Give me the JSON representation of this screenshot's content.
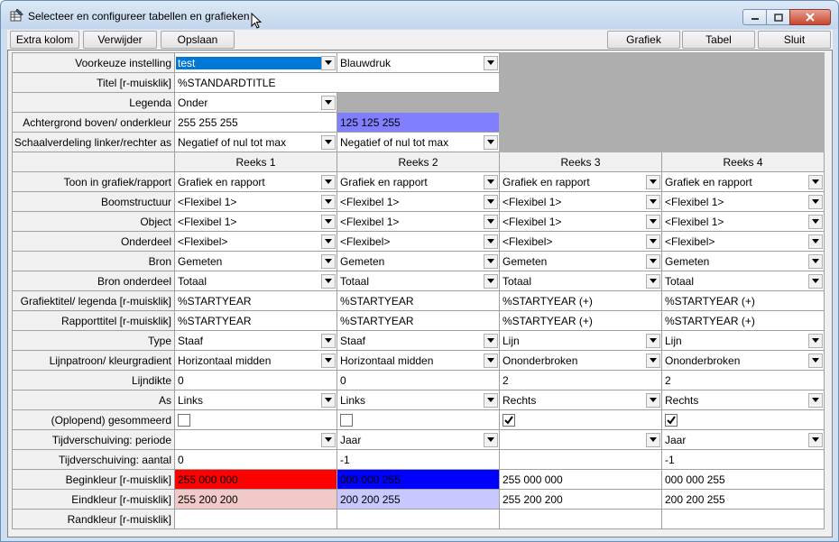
{
  "window": {
    "title": "Selecteer en configureer tabellen en grafieken"
  },
  "toolbar": {
    "extra_kolom": "Extra kolom",
    "verwijder": "Verwijder",
    "opslaan": "Opslaan",
    "grafiek": "Grafiek",
    "tabel": "Tabel",
    "sluit": "Sluit"
  },
  "settings": {
    "voorkeuze_label": "Voorkeuze instelling",
    "voorkeuze_value": "test",
    "voorkeuze_value2": "Blauwdruk",
    "titel_label": "Titel [r-muisklik]",
    "titel_value": "%STANDARDTITLE",
    "legenda_label": "Legenda",
    "legenda_value": "Onder",
    "achtergrond_label": "Achtergrond boven/ onderkleur",
    "achtergrond_top": "255 255 255",
    "achtergrond_bottom": "125 125 255",
    "achtergrond_bottom_color": "#8080ff",
    "schaal_label": "Schaalverdeling linker/rechter as",
    "schaal_left": "Negatief of nul tot max",
    "schaal_right": "Negatief of nul tot max"
  },
  "series_headers": [
    "Reeks 1",
    "Reeks 2",
    "Reeks 3",
    "Reeks 4"
  ],
  "rows": [
    {
      "label": "Toon in grafiek/rapport",
      "kind": "dropdown",
      "values": [
        "Grafiek en rapport",
        "Grafiek en rapport",
        "Grafiek en rapport",
        "Grafiek en rapport"
      ]
    },
    {
      "label": "Boomstructuur",
      "kind": "dropdown",
      "values": [
        "<Flexibel 1>",
        "<Flexibel 1>",
        "<Flexibel 1>",
        "<Flexibel 1>"
      ]
    },
    {
      "label": "Object",
      "kind": "dropdown",
      "values": [
        "<Flexibel 1>",
        "<Flexibel 1>",
        "<Flexibel 1>",
        "<Flexibel 1>"
      ]
    },
    {
      "label": "Onderdeel",
      "kind": "dropdown",
      "values": [
        "<Flexibel>",
        "<Flexibel>",
        "<Flexibel>",
        "<Flexibel>"
      ]
    },
    {
      "label": "Bron",
      "kind": "dropdown",
      "values": [
        "Gemeten",
        "Gemeten",
        "Gemeten",
        "Gemeten"
      ]
    },
    {
      "label": "Bron onderdeel",
      "kind": "dropdown",
      "values": [
        "Totaal",
        "Totaal",
        "Totaal",
        "Totaal"
      ]
    },
    {
      "label": "Grafiektitel/ legenda [r-muisklik]",
      "kind": "text",
      "values": [
        "%STARTYEAR",
        "%STARTYEAR",
        "%STARTYEAR (+)",
        "%STARTYEAR (+)"
      ]
    },
    {
      "label": "Rapporttitel [r-muisklik]",
      "kind": "text",
      "values": [
        "%STARTYEAR",
        "%STARTYEAR",
        "%STARTYEAR (+)",
        "%STARTYEAR (+)"
      ]
    },
    {
      "label": "Type",
      "kind": "dropdown",
      "values": [
        "Staaf",
        "Staaf",
        "Lijn",
        "Lijn"
      ]
    },
    {
      "label": "Lijnpatroon/ kleurgradient",
      "kind": "dropdown",
      "values": [
        "Horizontaal midden",
        "Horizontaal midden",
        "Ononderbroken",
        "Ononderbroken"
      ]
    },
    {
      "label": "Lijndikte",
      "kind": "text",
      "values": [
        "0",
        "0",
        "2",
        "2"
      ]
    },
    {
      "label": "As",
      "kind": "dropdown",
      "values": [
        "Links",
        "Links",
        "Rechts",
        "Rechts"
      ]
    },
    {
      "label": "(Oplopend) gesommeerd",
      "kind": "checkbox",
      "values": [
        false,
        false,
        true,
        true
      ]
    },
    {
      "label": "Tijdverschuiving: periode",
      "kind": "dropdown",
      "values": [
        "",
        "Jaar",
        "",
        "Jaar"
      ]
    },
    {
      "label": "Tijdverschuiving: aantal",
      "kind": "text",
      "values": [
        "0",
        "-1",
        "",
        "-1"
      ]
    },
    {
      "label": "Beginkleur [r-muisklik]",
      "kind": "color",
      "values": [
        "255 000 000",
        "000 000 255",
        "255 000 000",
        "000 000 255"
      ],
      "colors": [
        "#ff0000",
        "#0000ff",
        "",
        ""
      ]
    },
    {
      "label": "Eindkleur [r-muisklik]",
      "kind": "color",
      "values": [
        "255 200 200",
        "200 200 255",
        "255 200 200",
        "200 200 255"
      ],
      "colors": [
        "#f2c9c9",
        "#c8c8ff",
        "",
        ""
      ]
    },
    {
      "label": "Randkleur [r-muisklik]",
      "kind": "text",
      "values": [
        "",
        "",
        "",
        ""
      ]
    }
  ]
}
